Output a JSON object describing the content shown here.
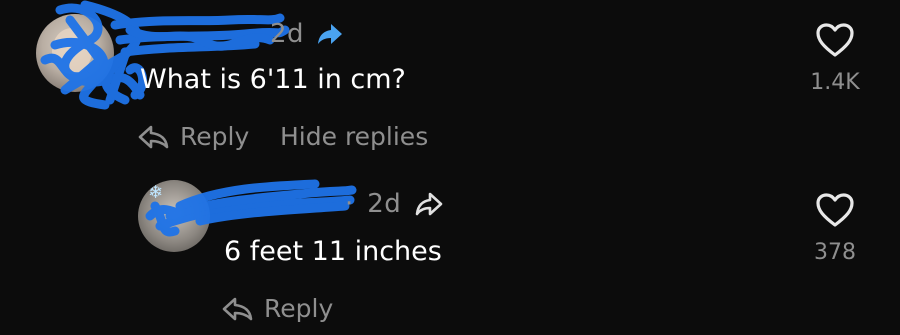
{
  "comment": {
    "time": "2d",
    "text": "What is 6'11 in cm?",
    "likes": "1.4K",
    "reply_label": "Reply",
    "hide_replies_label": "Hide replies",
    "icons": {
      "share": "share-arrow-filled-icon",
      "like": "heart-outline-icon",
      "reply": "reply-arrow-icon"
    }
  },
  "reply": {
    "dot": "·",
    "time": "2d",
    "text": "6 feet 11 inches",
    "likes": "378",
    "reply_label": "Reply",
    "icons": {
      "share": "share-arrow-outline-icon",
      "like": "heart-outline-icon",
      "reply": "reply-arrow-icon"
    }
  },
  "colors": {
    "background": "#0c0c0c",
    "text": "#ffffff",
    "muted": "#8f8f8f",
    "accent_share": "#4aa3f0",
    "redaction": "#1e73e8"
  }
}
